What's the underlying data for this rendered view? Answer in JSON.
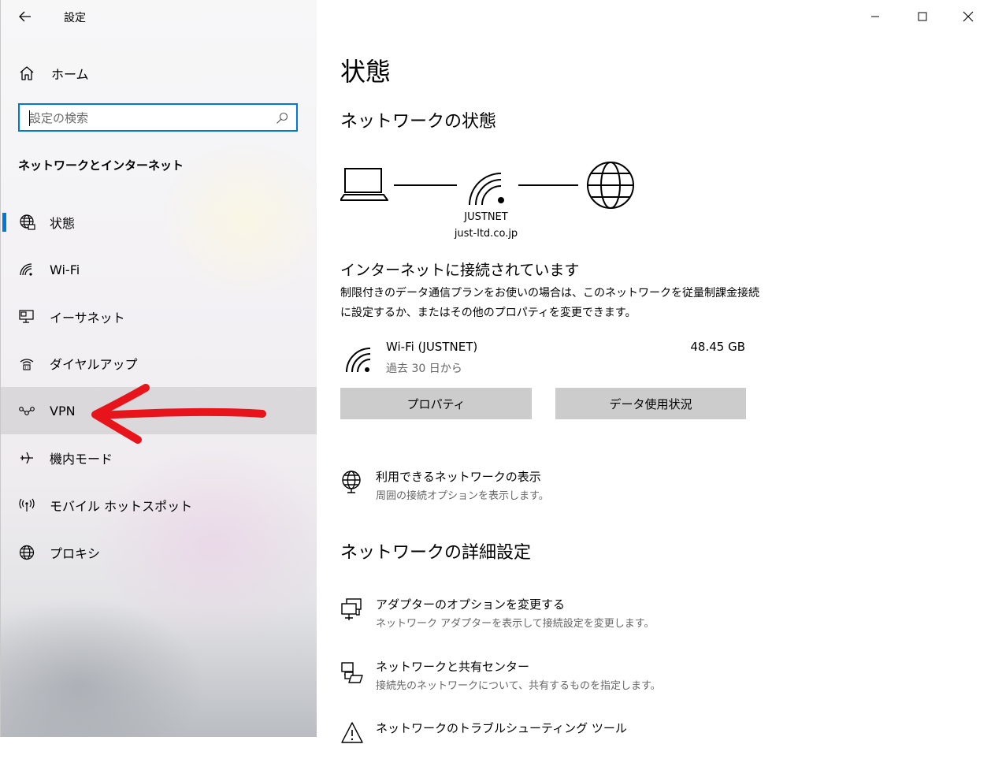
{
  "window": {
    "title": "設定",
    "controls": {
      "minimize": "minimize-icon",
      "maximize": "maximize-icon",
      "close": "close-icon"
    }
  },
  "sidebar": {
    "home_label": "ホーム",
    "search_placeholder": "設定の検索",
    "section_title": "ネットワークとインターネット",
    "items": [
      {
        "label": "状態",
        "icon": "globe-status-icon",
        "selected": true
      },
      {
        "label": "Wi-Fi",
        "icon": "wifi-icon"
      },
      {
        "label": "イーサネット",
        "icon": "ethernet-icon"
      },
      {
        "label": "ダイヤルアップ",
        "icon": "dialup-icon"
      },
      {
        "label": "VPN",
        "icon": "vpn-icon",
        "hovered": true
      },
      {
        "label": "機内モード",
        "icon": "airplane-icon"
      },
      {
        "label": "モバイル ホットスポット",
        "icon": "hotspot-icon"
      },
      {
        "label": "プロキシ",
        "icon": "globe-icon"
      }
    ],
    "annotation_color": "#e8141c"
  },
  "main": {
    "title": "状態",
    "network_status_heading": "ネットワークの状態",
    "network": {
      "name": "JUSTNET",
      "domain": "just-ltd.co.jp"
    },
    "connected_title": "インターネットに接続されています",
    "connected_desc": "制限付きのデータ通信プランをお使いの場合は、このネットワークを従量制課金接続に設定するか、またはその他のプロパティを変更できます。",
    "connection": {
      "name": "Wi-Fi (JUSTNET)",
      "period": "過去 30 日から",
      "usage": "48.45 GB"
    },
    "buttons": {
      "properties": "プロパティ",
      "data_usage": "データ使用状況"
    },
    "available_networks": {
      "title": "利用できるネットワークの表示",
      "desc": "周囲の接続オプションを表示します。"
    },
    "advanced_heading": "ネットワークの詳細設定",
    "advanced_items": [
      {
        "title": "アダプターのオプションを変更する",
        "desc": "ネットワーク アダプターを表示して接続設定を変更します。"
      },
      {
        "title": "ネットワークと共有センター",
        "desc": "接続先のネットワークについて、共有するものを指定します。"
      },
      {
        "title": "ネットワークのトラブルシューティング ツール",
        "desc": ""
      }
    ]
  },
  "colors": {
    "accent": "#0078d7",
    "button_bg": "#cccccc",
    "secondary_text": "#666666"
  }
}
